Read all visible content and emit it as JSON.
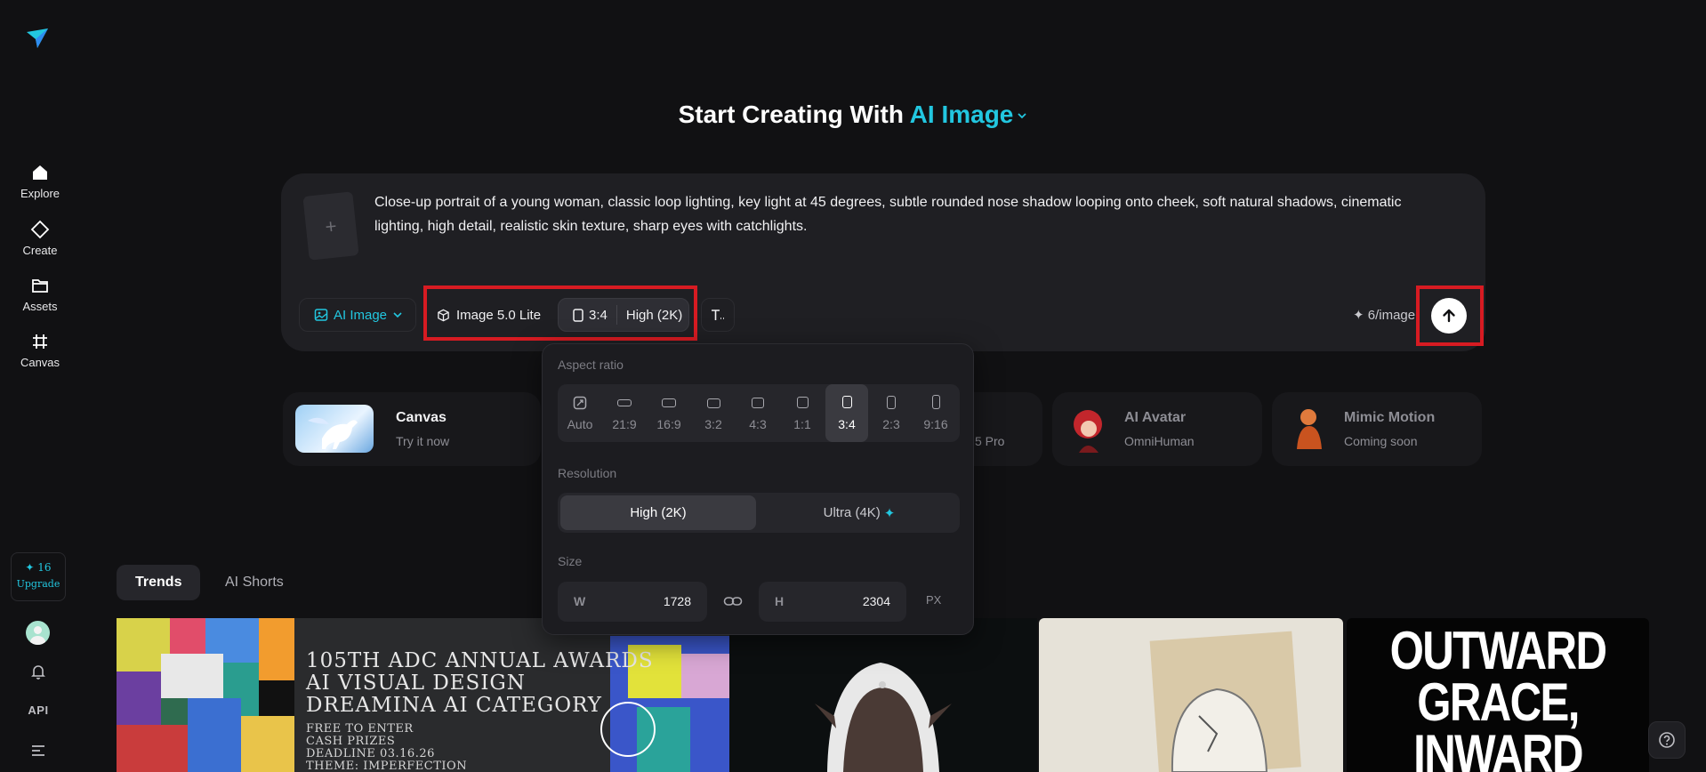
{
  "sidebar": {
    "items": [
      {
        "label": "Explore",
        "icon": "home-icon"
      },
      {
        "label": "Create",
        "icon": "diamond-icon"
      },
      {
        "label": "Assets",
        "icon": "folder-icon"
      },
      {
        "label": "Canvas",
        "icon": "canvas-frame-icon"
      }
    ],
    "credits": "✦ 16",
    "upgrade_label": "Upgrade",
    "api_label": "API"
  },
  "headline": {
    "prefix": "Start Creating With",
    "mode": "AI Image"
  },
  "prompt": {
    "text": "Close-up portrait of a young woman, classic loop lighting, key light at 45 degrees, subtle rounded nose shadow looping onto cheek, soft natural shadows, cinematic lighting, high detail, realistic skin texture, sharp eyes with catchlights.",
    "add_reference": "+"
  },
  "toolbar": {
    "mode_label": "AI Image",
    "model_label": "Image 5.0 Lite",
    "ratio_label": "3:4",
    "resolution_label": "High (2K)",
    "price": "✦ 6/image"
  },
  "cards": [
    {
      "title": "Canvas",
      "sub": "Try it now"
    },
    {
      "title": "",
      "sub": "5 Pro"
    },
    {
      "title": "AI Avatar",
      "sub": "OmniHuman"
    },
    {
      "title": "Mimic Motion",
      "sub": "Coming soon"
    }
  ],
  "popover": {
    "aspect_label": "Aspect ratio",
    "ratios": [
      "Auto",
      "21:9",
      "16:9",
      "3:2",
      "4:3",
      "1:1",
      "3:4",
      "2:3",
      "9:16"
    ],
    "selected_ratio": "3:4",
    "resolution_label": "Resolution",
    "res_high": "High (2K)",
    "res_ultra": "Ultra (4K)",
    "size_label": "Size",
    "w_label": "W",
    "w_value": "1728",
    "h_label": "H",
    "h_value": "2304",
    "unit": "PX"
  },
  "tabs": [
    "Trends",
    "AI Shorts"
  ],
  "gallery": {
    "adc_lines": [
      "105TH ADC ANNUAL AWARDS",
      "AI VISUAL DESIGN",
      "DREAMINA AI CATEGORY"
    ],
    "adc_small": [
      "FREE TO ENTER",
      "CASH PRIZES",
      "DEADLINE 03.16.26",
      "THEME: IMPERFECTION"
    ],
    "poster_lines": [
      "OUTWARD",
      "GRACE,",
      "INWARD"
    ]
  },
  "colors": {
    "accent": "#22c7e0",
    "background": "#111113",
    "highlight_box": "#d71b22"
  }
}
